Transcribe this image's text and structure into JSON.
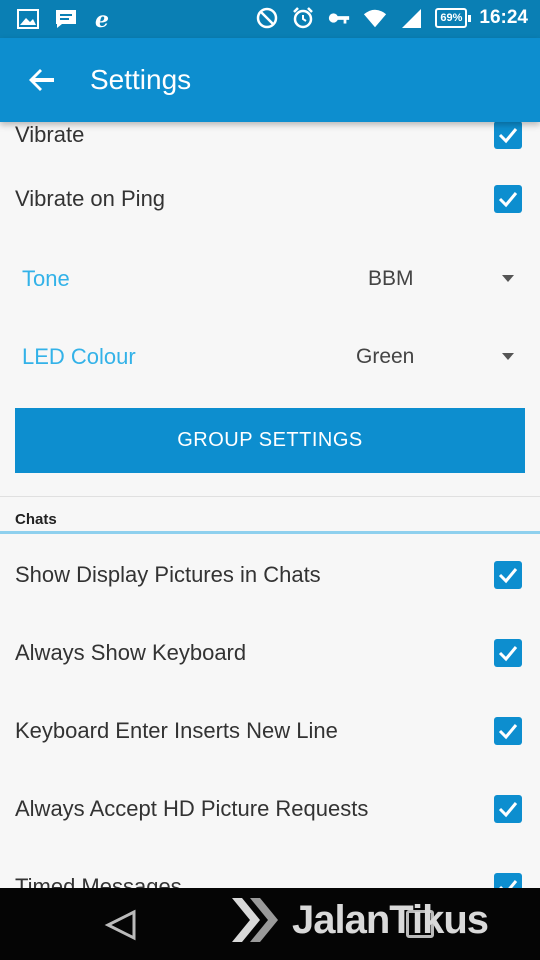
{
  "status_bar": {
    "time": "16:24",
    "battery": "69%",
    "left_icons": [
      "image-icon",
      "message-icon",
      "e-icon"
    ],
    "right_icons": [
      "blocked-icon",
      "alarm-icon",
      "key-icon",
      "wifi-icon",
      "signal-icon"
    ]
  },
  "app_bar": {
    "title": "Settings",
    "back_icon": "arrow-left-icon"
  },
  "settings": {
    "vibrate_label": "Vibrate",
    "vibrate_on_ping_label": "Vibrate on Ping",
    "tone_label": "Tone",
    "tone_value": "BBM",
    "led_colour_label": "LED Colour",
    "led_colour_value": "Green",
    "group_settings_label": "GROUP SETTINGS",
    "chats_header": "Chats",
    "chat_options": [
      {
        "label": "Show Display Pictures in Chats",
        "checked": true
      },
      {
        "label": "Always Show Keyboard",
        "checked": true
      },
      {
        "label": "Keyboard Enter Inserts New Line",
        "checked": true
      },
      {
        "label": "Always Accept HD Picture Requests",
        "checked": true
      },
      {
        "label": "Timed Messages",
        "checked": true
      }
    ]
  },
  "watermark": {
    "text": "JalanTikus"
  },
  "colors": {
    "status_bar": "#0a7fb4",
    "app_bar": "#0d8ecf",
    "accent_label": "#33b2e8",
    "checkbox": "#0d8ecf"
  }
}
